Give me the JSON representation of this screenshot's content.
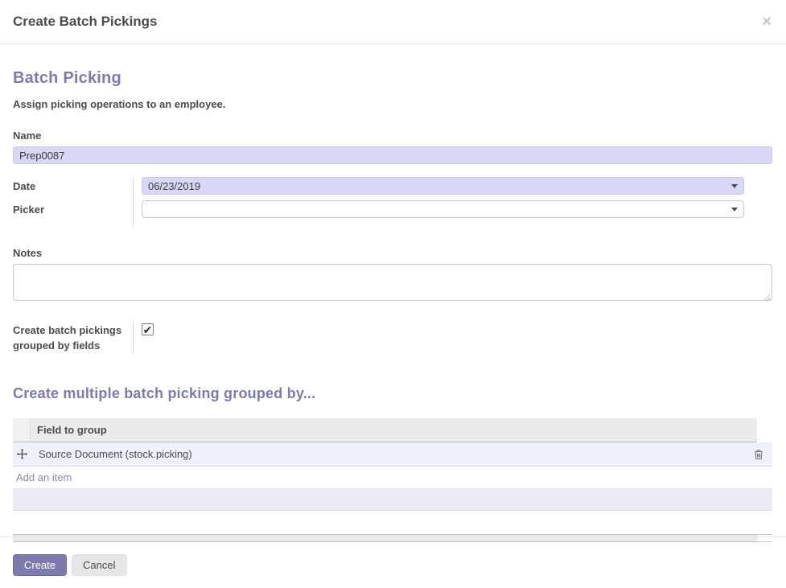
{
  "modal": {
    "title": "Create Batch Pickings",
    "close_glyph": "×"
  },
  "form": {
    "heading": "Batch Picking",
    "subtitle": "Assign picking operations to an employee.",
    "fields": {
      "name": {
        "label": "Name",
        "value": "Prep0087"
      },
      "date": {
        "label": "Date",
        "value": "06/23/2019"
      },
      "picker": {
        "label": "Picker",
        "value": ""
      },
      "notes": {
        "label": "Notes",
        "value": ""
      },
      "grouped": {
        "label": "Create batch pickings grouped by fields",
        "checked": true
      }
    }
  },
  "group_section": {
    "heading": "Create multiple batch picking grouped by...",
    "table": {
      "columns": [
        "Field to group"
      ],
      "rows": [
        {
          "field": "Source Document (stock.picking)"
        }
      ],
      "add_item_label": "Add an item"
    }
  },
  "footer": {
    "create_label": "Create",
    "cancel_label": "Cancel"
  },
  "icons": {
    "check": "✔"
  },
  "colors": {
    "accent_purple": "#7c7bad",
    "field_bg": "#d8d8f6",
    "row_bg": "#eef0fa",
    "empty_row_bg": "#ebebf4",
    "table_header_bg": "#ebebeb",
    "create_button_bg": "#7c7bad",
    "cancel_button_bg": "#e7e7e7",
    "text": "#4c4c4c"
  }
}
